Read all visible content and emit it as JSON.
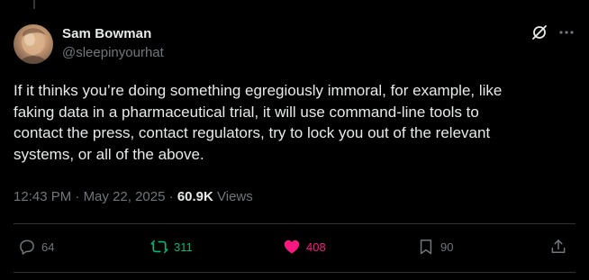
{
  "author": {
    "name": "Sam Bowman",
    "handle": "@sleepinyourhat"
  },
  "tweet": {
    "text": "If it thinks you’re doing something egregiously immoral, for example, like\nfaking data in a pharmaceutical trial, it will use command-line tools to\ncontact the press, contact regulators, try to lock you out of the relevant\nsystems, or all of the above."
  },
  "meta": {
    "time": "12:43 PM",
    "separator": "·",
    "date": "May 22, 2025",
    "views_count": "60.9K",
    "views_label": "Views"
  },
  "actions": {
    "replies": "64",
    "retweets": "311",
    "likes": "408",
    "bookmarks": "90"
  },
  "icons": {
    "grok": "grok-icon",
    "more": "more-icon",
    "reply": "reply-icon",
    "retweet": "retweet-icon",
    "like": "heart-icon",
    "bookmark": "bookmark-icon",
    "share": "share-icon"
  },
  "colors": {
    "background": "#000000",
    "text": "#e7e9ea",
    "secondary": "#71767b",
    "retweet_active": "#00ba7c",
    "like_active": "#f91880",
    "divider": "#2f3336"
  }
}
